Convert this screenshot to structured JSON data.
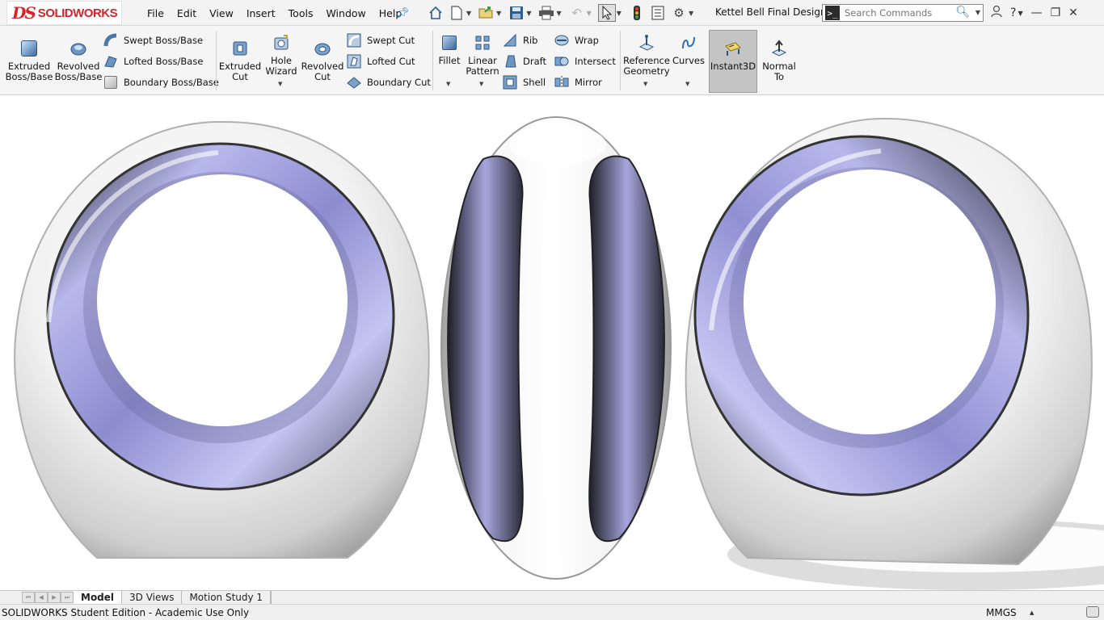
{
  "app": {
    "logo_mark": "DS",
    "logo_text": "SOLIDWORKS",
    "document_title": "Kettel Bell Final Design..."
  },
  "menu": {
    "items": [
      "File",
      "Edit",
      "View",
      "Insert",
      "Tools",
      "Window",
      "Help"
    ]
  },
  "search": {
    "placeholder": "Search Commands"
  },
  "ribbon": {
    "extruded_boss": [
      "Extruded",
      "Boss/Base"
    ],
    "revolved_boss": [
      "Revolved",
      "Boss/Base"
    ],
    "swept_boss": "Swept Boss/Base",
    "lofted_boss": "Lofted Boss/Base",
    "boundary_boss": "Boundary Boss/Base",
    "extruded_cut": [
      "Extruded",
      "Cut"
    ],
    "hole_wizard": [
      "Hole",
      "Wizard"
    ],
    "revolved_cut": [
      "Revolved",
      "Cut"
    ],
    "swept_cut": "Swept Cut",
    "lofted_cut": "Lofted Cut",
    "boundary_cut": "Boundary Cut",
    "fillet": "Fillet",
    "linear_pattern": [
      "Linear",
      "Pattern"
    ],
    "rib": "Rib",
    "draft": "Draft",
    "shell": "Shell",
    "wrap": "Wrap",
    "intersect": "Intersect",
    "mirror": "Mirror",
    "reference_geometry": [
      "Reference",
      "Geometry"
    ],
    "curves": "Curves",
    "instant3d": "Instant3D",
    "normal_to": [
      "Normal",
      "To"
    ]
  },
  "tabs": {
    "model": "Model",
    "views_3d": "3D Views",
    "motion_study": "Motion Study 1"
  },
  "status": {
    "edition": "SOLIDWORKS Student Edition - Academic Use Only",
    "units": "MMGS"
  },
  "colors": {
    "brand_red": "#d8232a",
    "accent_blue": "#2d6fb6",
    "inner_surface": "#a8a8e0",
    "body_surface": "#eeeeee"
  },
  "icons": {
    "home": "home-icon",
    "new": "new-document-icon",
    "open": "open-folder-icon",
    "save": "save-icon",
    "print": "print-icon",
    "undo": "undo-icon",
    "select": "select-arrow-icon",
    "rebuild": "rebuild-traffic-light-icon",
    "file_properties": "file-properties-icon",
    "options": "gear-icon",
    "user": "user-icon",
    "help": "help-icon"
  }
}
